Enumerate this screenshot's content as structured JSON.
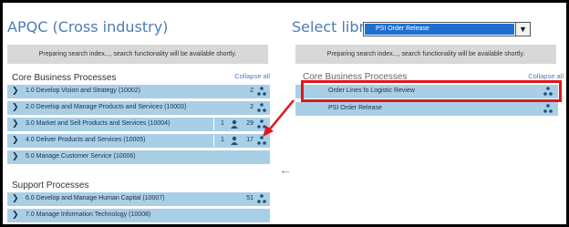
{
  "left": {
    "title": "APQC (Cross industry)",
    "notice": "Preparing search index..., search functionality will be available shortly.",
    "core_label": "Core Business Processes",
    "collapse_label": "Collapse all",
    "core_items": [
      {
        "label": "1.0 Develop Vision and Strategy (10002)",
        "count": "2",
        "users": ""
      },
      {
        "label": "2.0 Develop and Manage Products and Services (10003)",
        "count": "2",
        "users": ""
      },
      {
        "label": "3.0 Market and Sell Products and Services (10004)",
        "count": "29",
        "users": "1"
      },
      {
        "label": "4.0 Deliver Products and Services (10005)",
        "count": "17",
        "users": "1"
      },
      {
        "label": "5.0 Manage Customer Service (10006)",
        "count": "",
        "users": ""
      }
    ],
    "support_label": "Support Processes",
    "support_items": [
      {
        "label": "6.0 Develop and Manage Human Capital (10007)",
        "count": "51",
        "users": ""
      },
      {
        "label": "7.0 Manage Information Technology (10008)",
        "count": "",
        "users": ""
      }
    ]
  },
  "right": {
    "title": "Select library",
    "selected_library": "PSI Order Release",
    "notice": "Preparing search index..., search functionality will be available shortly.",
    "core_label": "Core Business Processes",
    "collapse_label": "Collapse all",
    "items": [
      {
        "label": "Order Lines fo Logistic Review"
      },
      {
        "label": "PSI Order Release"
      }
    ]
  },
  "colors": {
    "accent": "#4a7eb6",
    "row": "#a9cfe6",
    "highlight": "#e3161d"
  },
  "icons": {
    "chevron": "chevron-right-icon",
    "hierarchy": "hierarchy-icon",
    "user": "user-icon"
  }
}
